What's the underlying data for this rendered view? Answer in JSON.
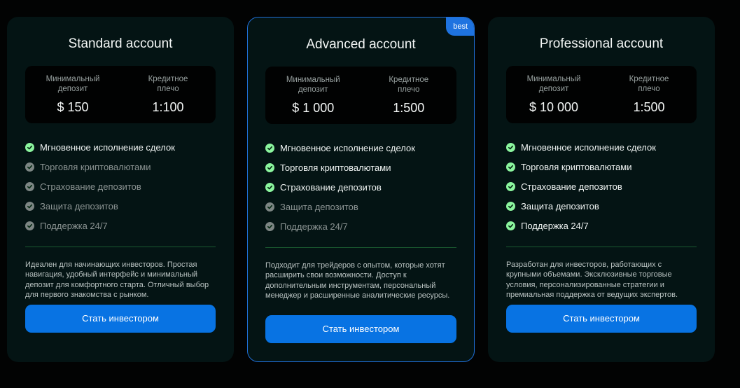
{
  "colors": {
    "background": "#020303",
    "card": "#041414",
    "accent": "#0873e3",
    "check_on": "#8bf59e",
    "check_off": "#7d8684"
  },
  "plans": [
    {
      "title": "Standard account",
      "deposit_label": "Минимальный\nдепозит",
      "deposit_value": "$ 150",
      "leverage_label": "Кредитное\nплечо",
      "leverage_value": "1:100",
      "features": [
        {
          "text": "Мгновенное исполнение сделок",
          "enabled": true
        },
        {
          "text": "Торговля криптовалютами",
          "enabled": false
        },
        {
          "text": "Страхование депозитов",
          "enabled": false
        },
        {
          "text": "Защита депозитов",
          "enabled": false
        },
        {
          "text": "Поддержка 24/7",
          "enabled": false
        }
      ],
      "description": "Идеален для начинающих инвесторов. Простая навигация, удобный интерфейс и минимальный депозит для комфортного старта. Отличный выбор для первого знакомства с рынком.",
      "button": "Стать инвестором"
    },
    {
      "title": "Advanced account",
      "badge": "best",
      "deposit_label": "Минимальный\nдепозит",
      "deposit_value": "$ 1 000",
      "leverage_label": "Кредитное\nплечо",
      "leverage_value": "1:500",
      "features": [
        {
          "text": "Мгновенное исполнение сделок",
          "enabled": true
        },
        {
          "text": "Торговля криптовалютами",
          "enabled": true
        },
        {
          "text": "Страхование депозитов",
          "enabled": true
        },
        {
          "text": "Защита депозитов",
          "enabled": false
        },
        {
          "text": "Поддержка 24/7",
          "enabled": false
        }
      ],
      "description": "Подходит для трейдеров с опытом, которые хотят расширить свои возможности. Доступ к дополнительным инструментам, персональный менеджер и расширенные аналитические ресурсы.",
      "button": "Стать инвестором"
    },
    {
      "title": "Professional account",
      "deposit_label": "Минимальный\nдепозит",
      "deposit_value": "$ 10 000",
      "leverage_label": "Кредитное\nплечо",
      "leverage_value": "1:500",
      "features": [
        {
          "text": "Мгновенное исполнение сделок",
          "enabled": true
        },
        {
          "text": "Торговля криптовалютами",
          "enabled": true
        },
        {
          "text": "Страхование депозитов",
          "enabled": true
        },
        {
          "text": "Защита депозитов",
          "enabled": true
        },
        {
          "text": "Поддержка 24/7",
          "enabled": true
        }
      ],
      "description": "Разработан для инвесторов, работающих с крупными объемами. Эксклюзивные торговые условия, персонализированные стратегии и премиальная поддержка от ведущих экспертов.",
      "button": "Стать инвестором"
    }
  ]
}
